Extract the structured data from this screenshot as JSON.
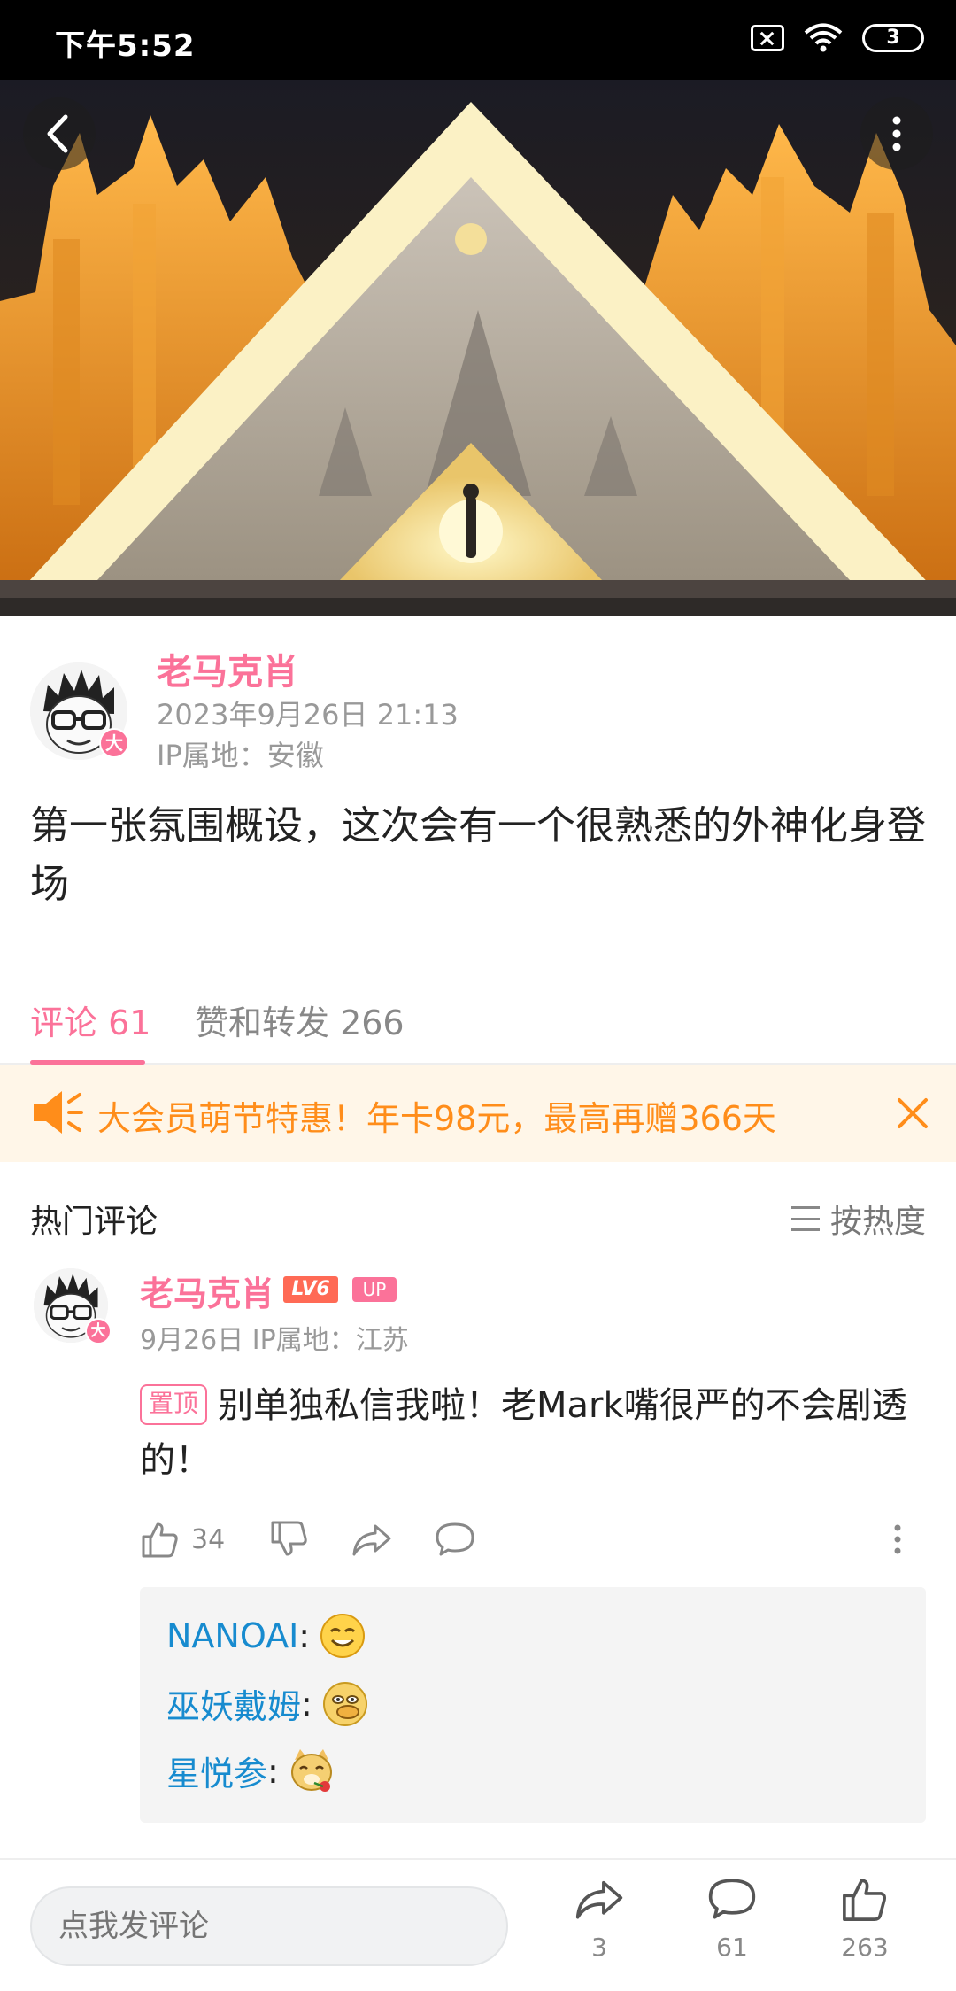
{
  "status_bar": {
    "time": "下午5:52",
    "battery": "3"
  },
  "post": {
    "author_name": "老马克肖",
    "avatar_badge": "大",
    "datetime": "2023年9月26日 21:13",
    "ip_location": "IP属地：安徽",
    "text": "第一张氛围概设，这次会有一个很熟悉的外神化身登场"
  },
  "tabs": {
    "comments": "评论 61",
    "likes_shares": "赞和转发 266"
  },
  "promo": {
    "text": "大会员萌节特惠！年卡98元，最高再赠366天"
  },
  "comments_section": {
    "title": "热门评论",
    "sort_label": "按热度"
  },
  "comment": {
    "author": "老马克肖",
    "level": "LV6",
    "up_tag": "UP",
    "avatar_badge": "大",
    "meta": "9月26日  IP属地：江苏",
    "pin_tag": "置顶",
    "text": "别单独私信我啦！老Mark嘴很严的不会剧透的！",
    "like_count": "34",
    "replies": [
      {
        "user": "NANOAI",
        "colon": ":",
        "emoji": "smiling-face"
      },
      {
        "user": "巫妖戴姆",
        "colon": ":",
        "emoji": "doge-face"
      },
      {
        "user": "星悦参",
        "colon": ":",
        "emoji": "cat-rose-face"
      }
    ]
  },
  "bottom_bar": {
    "input_placeholder": "点我发评论",
    "share_count": "3",
    "comment_count": "61",
    "like_count": "263"
  },
  "colors": {
    "accent": "#fb7299",
    "promo": "#ff8d1a",
    "reply_link": "#178bcf"
  }
}
